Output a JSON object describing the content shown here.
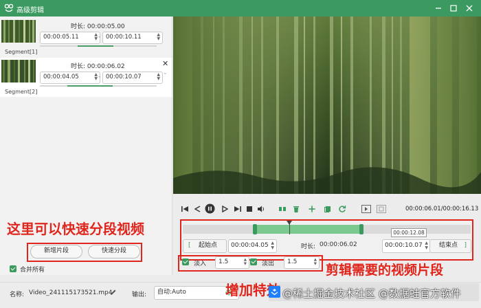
{
  "window": {
    "title": "高级剪辑",
    "icon": "frog-logo-icon",
    "controls": [
      "minimize-icon",
      "maximize-icon",
      "close-icon"
    ]
  },
  "segments": [
    {
      "name": "Segment[1]",
      "duration_label": "时长:",
      "duration": "00:00:05.00",
      "start": "00:00:05.11",
      "end": "00:00:10.11",
      "selected": false
    },
    {
      "name": "Segment[2]",
      "duration_label": "时长:",
      "duration": "00:00:06.02",
      "start": "00:00:04.05",
      "end": "00:00:10.07",
      "selected": true
    }
  ],
  "segment_actions": {
    "add_segment": "新增片段",
    "quick_split": "快速分段"
  },
  "merge_all": {
    "label": "合并所有",
    "checked": true
  },
  "playback": {
    "time_display": "00:00:06.01/00:00:16.13",
    "controls": [
      "go-start-icon",
      "step-back-icon",
      "pause-icon",
      "step-forward-icon",
      "stop-icon",
      "volume-icon",
      "split-icon",
      "delete-icon",
      "add-icon",
      "copy-icon",
      "reset-icon",
      "mark-in-icon",
      "mark-out-icon"
    ]
  },
  "trim": {
    "playhead_tooltip": "00:00:12.08",
    "start_label": "起始点",
    "start_value": "00:00:04.05",
    "duration_label": "时长:",
    "duration_value": "00:00:06.02",
    "end_value": "00:00:10.07",
    "end_label": "结束点",
    "selection_start_fraction": 0.25,
    "selection_end_fraction": 0.62,
    "playhead_fraction": 0.37
  },
  "fades": {
    "fade_in_label": "淡入",
    "fade_in_value": "1.5",
    "fade_in_checked": true,
    "fade_out_label": "淡出",
    "fade_out_value": "1.5",
    "fade_out_checked": true
  },
  "footer": {
    "name_label": "名称:",
    "file_name": "Video_241115173521.mp4",
    "output_label": "输出:",
    "output_value": "自动:Auto"
  },
  "annotations": {
    "split_note": "这里可以快速分段视频",
    "clip_note": "剪辑需要的视频片段",
    "fade_note": "增加特效"
  },
  "watermark": "@稀土掘金技术社区 @数据蛙官方软件",
  "colors": {
    "brand_green": "#3a9a5f",
    "annotation_red": "#e0251c",
    "selection_green": "#7cc98f"
  }
}
